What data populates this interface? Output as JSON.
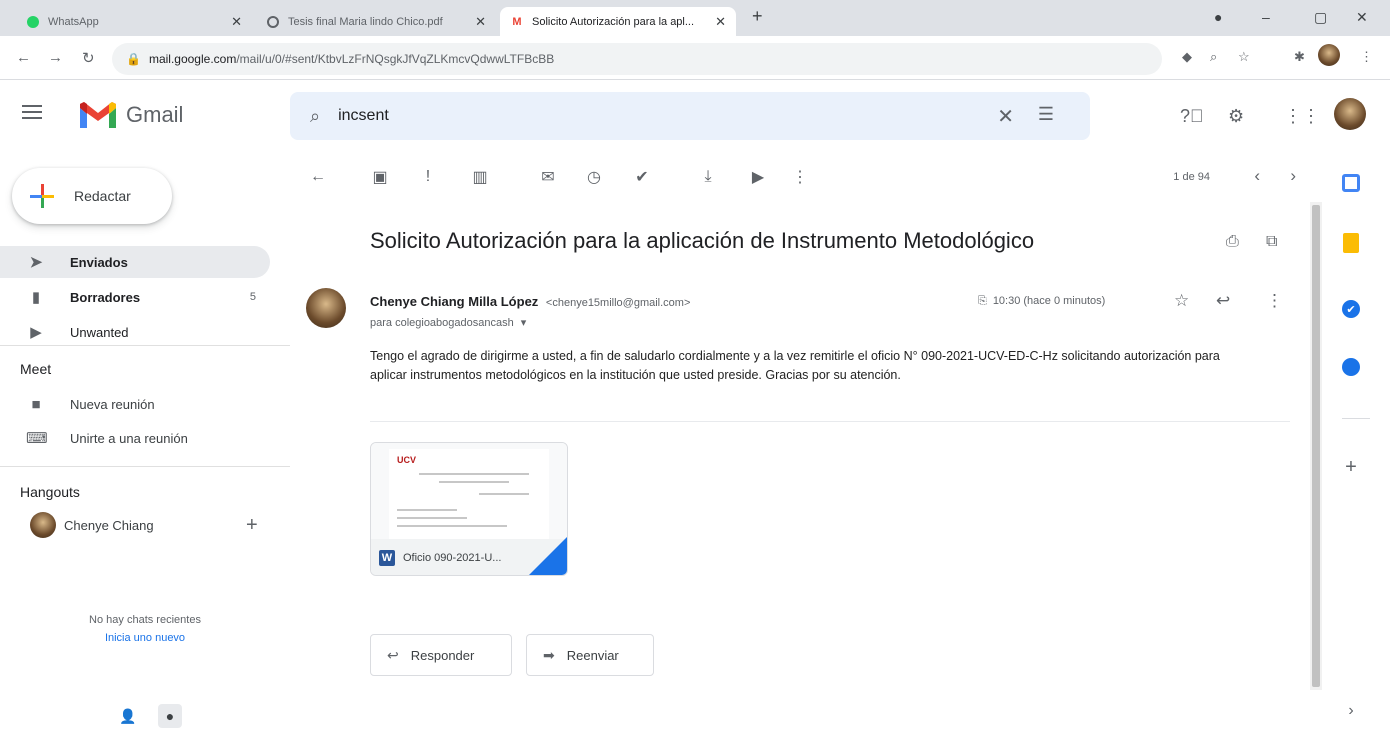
{
  "browser": {
    "tabs": [
      {
        "title": "WhatsApp"
      },
      {
        "title": "Tesis final Maria lindo Chico.pdf"
      },
      {
        "title": "Solicito Autorización para la apl..."
      }
    ],
    "url": {
      "host": "mail.google.com",
      "path": "/mail/u/0/#sent/KtbvLzFrNQsgkJfVqZLKmcvQdwwLTFBcBB"
    }
  },
  "header": {
    "app_name": "Gmail",
    "search_value": "incsent"
  },
  "sidebar": {
    "compose_label": "Redactar",
    "items": [
      {
        "label": "Enviados",
        "count": ""
      },
      {
        "label": "Borradores",
        "count": "5"
      },
      {
        "label": "Unwanted",
        "count": ""
      }
    ],
    "meet": {
      "title": "Meet",
      "items": [
        {
          "label": "Nueva reunión"
        },
        {
          "label": "Unirte a una reunión"
        }
      ]
    },
    "hangouts": {
      "title": "Hangouts",
      "user": "Chenye Chiang",
      "no_chats": "No hay chats recientes",
      "start_new": "Inicia uno nuevo"
    }
  },
  "toolbar": {
    "pager": "1 de 94"
  },
  "email": {
    "subject": "Solicito Autorización para la aplicación de Instrumento Metodológico",
    "sender_name": "Chenye Chiang Milla López",
    "sender_email": "<chenye15millo@gmail.com>",
    "recipient": "para colegioabogadosancash",
    "time": "10:30 (hace 0 minutos)",
    "body": "Tengo el agrado de dirigirme a usted, a fin de saludarlo cordialmente y a la vez remitirle el oficio N° 090-2021-UCV-ED-C-Hz solicitando autorización para aplicar instrumentos metodológicos en la institución que usted preside. Gracias por su atención.",
    "attachment": {
      "logo": "UCV",
      "name": "Oficio 090-2021-U..."
    },
    "reply_label": "Responder",
    "forward_label": "Reenviar"
  },
  "colors": {
    "gmail_red": "#ea4335",
    "gmail_blue": "#4285f4",
    "gmail_green": "#34a853",
    "gmail_yellow": "#fbbc04",
    "link_blue": "#1a73e8"
  }
}
